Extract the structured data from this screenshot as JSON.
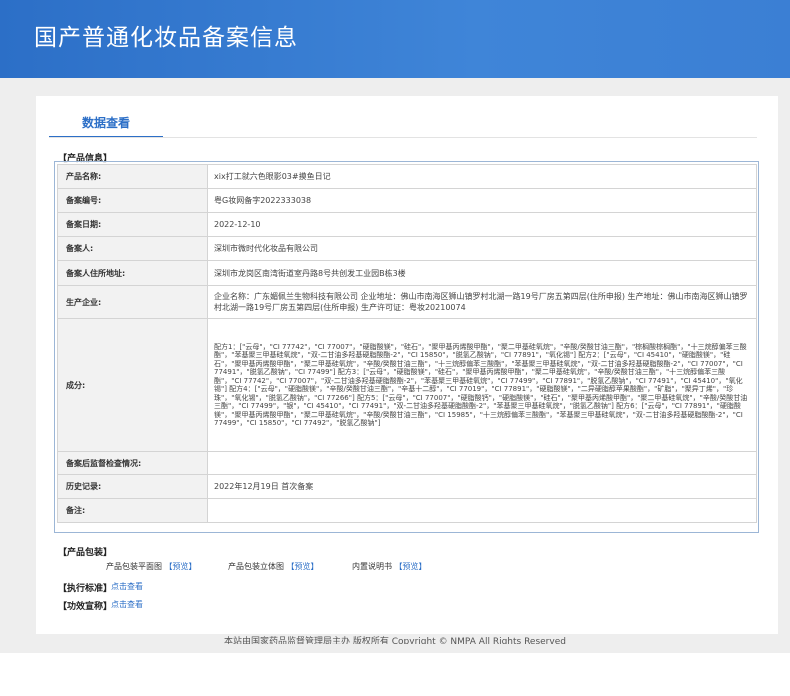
{
  "header": {
    "title": "国产普通化妆品备案信息"
  },
  "tab": {
    "label": "数据查看"
  },
  "sections": {
    "product_info": "【产品信息】",
    "packaging": "【产品包装】",
    "standard": "【执行标准】",
    "efficacy": "【功效宣称】"
  },
  "rows": [
    {
      "label": "产品名称:",
      "value": "xix打工就六色眼影03#摸鱼日记"
    },
    {
      "label": "备案编号:",
      "value": "粤G妆网备字2022333038"
    },
    {
      "label": "备案日期:",
      "value": "2022-12-10"
    },
    {
      "label": "备案人:",
      "value": "深圳市微时代化妆品有限公司"
    },
    {
      "label": "备案人住所地址:",
      "value": "深圳市龙岗区南湾街道室丹路8号共创发工业园B栋3楼"
    },
    {
      "label": "生产企业:",
      "value": "企业名称：广东媚佩兰生物科技有限公司 企业地址：佛山市南海区狮山镇罗村北湖一路19号厂房五第四层(住所申报) 生产地址：佛山市南海区狮山镇罗村北湖一路19号厂房五第四层(住所申报) 生产许可证：粤妆20210074"
    },
    {
      "label": "成分:",
      "value": "配方1：[\"云母\"，\"CI 77742\"，\"CI 77007\"，\"硬脂酸镁\"，\"硅石\"，\"聚甲基丙烯酸甲酯\"，\"聚二甲基硅氧烷\"，\"辛酸/癸酸甘油三酯\"，\"棕榈酸棕榈酯\"，\"十三烷醇偏苯三酸酯\"，\"苯基聚三甲基硅氧烷\"，\"双-二甘油多羟基硬脂酸酯-2\"，\"CI 15850\"，\"脱氢乙酸钠\"，\"CI 77891\"，\"氧化锡\"] 配方2：[\"云母\"，\"CI 45410\"，\"硬脂酸镁\"，\"硅石\"，\"聚甲基丙烯酸甲酯\"，\"聚二甲基硅氧烷\"，\"辛酸/癸酸甘油三酯\"，\"十三烷醇偏苯三酸酯\"，\"苯基聚三甲基硅氧烷\"，\"双-二甘油多羟基硬脂酸酯-2\"，\"CI 77007\"，\"CI 77491\"，\"脱氢乙酸钠\"，\"CI 77499\"] 配方3：[\"云母\"，\"硬脂酸镁\"，\"硅石\"，\"聚甲基丙烯酸甲酯\"，\"聚二甲基硅氧烷\"，\"辛酸/癸酸甘油三酯\"，\"十三烷醇偏苯三酸酯\"，\"CI 77742\"，\"CI 77007\"，\"双-二甘油多羟基硬脂酸酯-2\"，\"苯基聚三甲基硅氧烷\"，\"CI 77499\"，\"CI 77891\"，\"脱氢乙酸钠\"，\"CI 77491\"，\"CI 45410\"，\"氧化锡\"] 配方4：[\"云母\"，\"硬脂酸镁\"，\"辛酸/癸酸甘油三酯\"，\"辛基十二醇\"，\"CI 77019\"，\"CI 77891\"，\"硬脂酸镁\"，\"二异硬脂醇苹果酸酯\"，\"矿脂\"，\"聚异丁烯\"，\"珍珠\"，\"氧化锡\"，\"脱氢乙酸钠\"，\"CI 77266\"] 配方5：[\"云母\"，\"CI 77007\"，\"硬脂酸钙\"，\"硬脂酸镁\"，\"硅石\"，\"聚甲基丙烯酸甲酯\"，\"聚二甲基硅氧烷\"，\"辛酸/癸酸甘油三酯\"，\"CI 77499\"，\"银\"，\"CI 45410\"，\"CI 77491\"，\"双-二甘油多羟基硬脂酸酯-2\"，\"苯基聚三甲基硅氧烷\"，\"脱氢乙酸钠\"] 配方6：[\"云母\"，\"CI 77891\"，\"硬脂酸镁\"，\"聚甲基丙烯酸甲酯\"，\"聚二甲基硅氧烷\"，\"辛酸/癸酸甘油三酯\"，\"CI 15985\"，\"十三烷醇偏苯三酸酯\"，\"苯基聚三甲基硅氧烷\"，\"双-二甘油多羟基硬脂酸酯-2\"，\"CI 77499\"，\"CI 15850\"，\"CI 77492\"，\"脱氢乙酸钠\"]"
    },
    {
      "label": "备案后监督检查情况:",
      "value": ""
    },
    {
      "label": "历史记录:",
      "value": "2022年12月19日 首次备案"
    },
    {
      "label": "备注:",
      "value": ""
    }
  ],
  "packaging": {
    "items": [
      {
        "name": "产品包装平面图",
        "link": "【预览】"
      },
      {
        "name": "产品包装立体图",
        "link": "【预览】"
      },
      {
        "name": "内置说明书",
        "link": "【预览】"
      }
    ]
  },
  "links": {
    "standard_view": "点击查看",
    "efficacy_view": "点击查看"
  },
  "footer": {
    "text": "本站由国家药品监督管理局主办 版权所有 Copyright © NMPA All Rights Reserved"
  },
  "colors": {
    "header": "#3b7fd4",
    "accent": "#2c6fc7"
  }
}
